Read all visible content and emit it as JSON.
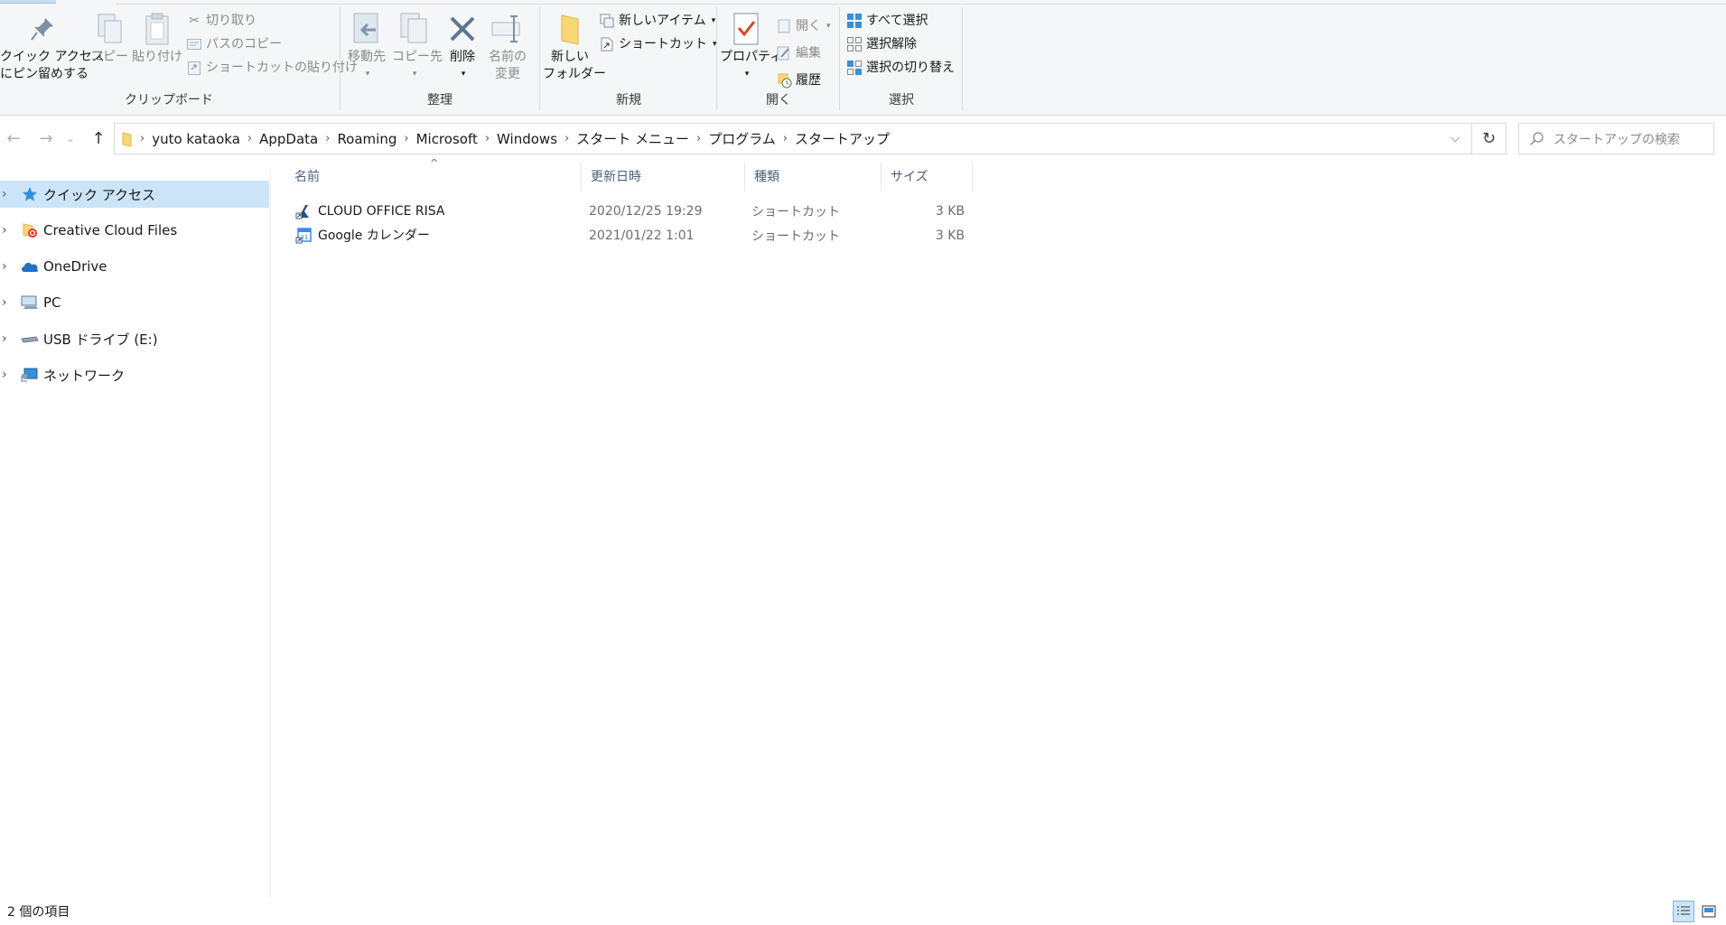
{
  "ribbon": {
    "clipboard": {
      "label": "クリップボード",
      "pin_line1": "クイック アクセス",
      "pin_line2": "にピン留めする",
      "copy": "コピー",
      "paste": "貼り付け",
      "cut": "切り取り",
      "copy_path": "パスのコピー",
      "paste_shortcut": "ショートカットの貼り付け"
    },
    "organize": {
      "label": "整理",
      "move_to": "移動先",
      "copy_to": "コピー先",
      "delete": "削除",
      "rename_line1": "名前の",
      "rename_line2": "変更"
    },
    "new": {
      "label": "新規",
      "new_folder_line1": "新しい",
      "new_folder_line2": "フォルダー",
      "new_item": "新しいアイテム",
      "shortcut": "ショートカット"
    },
    "open": {
      "label": "開く",
      "properties": "プロパティ",
      "open": "開く",
      "edit": "編集",
      "history": "履歴"
    },
    "select": {
      "label": "選択",
      "select_all": "すべて選択",
      "select_none": "選択解除",
      "invert": "選択の切り替え"
    }
  },
  "address": {
    "crumbs": [
      "yuto kataoka",
      "AppData",
      "Roaming",
      "Microsoft",
      "Windows",
      "スタート メニュー",
      "プログラム",
      "スタートアップ"
    ],
    "search_placeholder": "スタートアップの検索"
  },
  "navpane": {
    "items": [
      {
        "label": "クイック アクセス",
        "icon": "star-icon"
      },
      {
        "label": "Creative Cloud Files",
        "icon": "creative-cloud-icon"
      },
      {
        "label": "OneDrive",
        "icon": "cloud-icon"
      },
      {
        "label": "PC",
        "icon": "computer-icon"
      },
      {
        "label": "USB ドライブ (E:)",
        "icon": "usb-drive-icon"
      },
      {
        "label": "ネットワーク",
        "icon": "network-icon"
      }
    ]
  },
  "filelist": {
    "columns": {
      "name": "名前",
      "date": "更新日時",
      "type": "種類",
      "size": "サイズ"
    },
    "rows": [
      {
        "name": "CLOUD OFFICE RISA",
        "date": "2020/12/25 19:29",
        "type": "ショートカット",
        "size": "3 KB",
        "icon": "risa-shortcut-icon"
      },
      {
        "name": "Google カレンダー",
        "date": "2021/01/22 1:01",
        "type": "ショートカット",
        "size": "3 KB",
        "icon": "google-calendar-shortcut-icon"
      }
    ]
  },
  "status": {
    "item_count": "2 個の項目"
  },
  "colors": {
    "selection": "#cce4f7",
    "accent": "#0078d7",
    "folder": "#f8d775"
  }
}
